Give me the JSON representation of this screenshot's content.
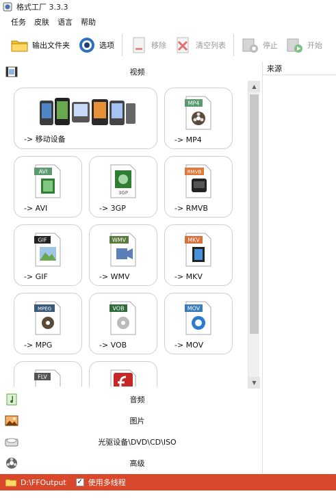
{
  "window": {
    "title": "格式工厂 3.3.3"
  },
  "menu": [
    "任务",
    "皮肤",
    "语言",
    "帮助"
  ],
  "toolbar": {
    "output_folder": "输出文件夹",
    "options": "选项",
    "remove": "移除",
    "clear_list": "清空列表",
    "stop": "停止",
    "start": "开始"
  },
  "categories": {
    "video": "视频",
    "audio": "音频",
    "picture": "图片",
    "rom": "光驱设备\\DVD\\CD\\ISO",
    "advanced": "高级"
  },
  "tiles": [
    {
      "label": "-> 移动设备",
      "badge": ""
    },
    {
      "label": "-> MP4",
      "badge": "MP4"
    },
    {
      "label": "-> AVI",
      "badge": "AVI"
    },
    {
      "label": "-> 3GP",
      "badge": "3GP"
    },
    {
      "label": "-> RMVB",
      "badge": "RMVB"
    },
    {
      "label": "-> GIF",
      "badge": "GIF"
    },
    {
      "label": "-> WMV",
      "badge": "WMV"
    },
    {
      "label": "-> MKV",
      "badge": "MKV"
    },
    {
      "label": "-> MPG",
      "badge": "MPEG"
    },
    {
      "label": "-> VOB",
      "badge": "VOB"
    },
    {
      "label": "-> MOV",
      "badge": "MOV"
    },
    {
      "label": "",
      "badge": "FLV"
    },
    {
      "label": "",
      "badge": ""
    }
  ],
  "task_list": {
    "column_source": "来源"
  },
  "status": {
    "output_path": "D:\\FFOutput",
    "multithread_label": "使用多线程",
    "multithread_checked": "✓"
  },
  "colors": {
    "status_bar": "#d9482a"
  }
}
